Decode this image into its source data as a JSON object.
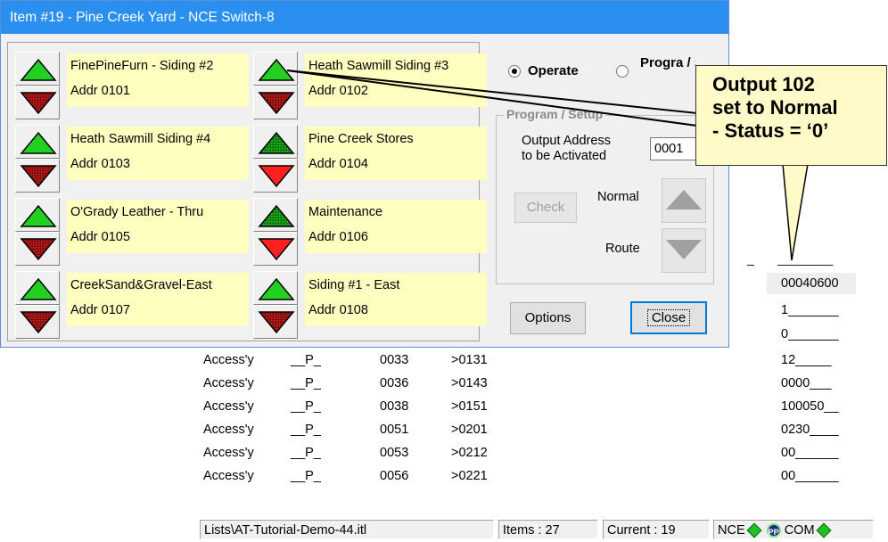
{
  "dialog": {
    "title": "Item #19 - Pine Creek Yard - NCE Switch-8",
    "switches": [
      {
        "name": "FinePineFurn - Siding #2",
        "addr": "Addr 0101",
        "up": "bright",
        "down": "dark"
      },
      {
        "name": "Heath Sawmill Siding #4",
        "addr": "Addr 0103",
        "up": "bright",
        "down": "dark"
      },
      {
        "name": "O'Grady Leather - Thru",
        "addr": "Addr 0105",
        "up": "bright",
        "down": "dark"
      },
      {
        "name": "CreekSand&Gravel-East",
        "addr": "Addr 0107",
        "up": "bright",
        "down": "dark"
      },
      {
        "name": "Heath Sawmill Siding #3",
        "addr": "Addr 0102",
        "up": "bright",
        "down": "dark"
      },
      {
        "name": "Pine Creek Stores",
        "addr": "Addr 0104",
        "up": "dark",
        "down": "bright"
      },
      {
        "name": "Maintenance",
        "addr": "Addr 0106",
        "up": "dark",
        "down": "bright"
      },
      {
        "name": "Siding #1 - East",
        "addr": "Addr 0108",
        "up": "bright",
        "down": "dark"
      }
    ],
    "mode": {
      "operate": "Operate",
      "program": "Progra / SetU"
    },
    "program_setup": {
      "title": "Program / Setup",
      "output_address_label_1": "Output Address",
      "output_address_label_2": "to be Activated",
      "output_address_value": "0001",
      "check": "Check",
      "normal": "Normal",
      "route": "Route"
    },
    "options": "Options",
    "close": "Close"
  },
  "callout": {
    "line1": "Output 102",
    "line2": "set to Normal",
    "line3": "- Status = ‘0’"
  },
  "background": {
    "dash": "_",
    "col_header_right": "________",
    "right_values": [
      "00040600",
      "1_______",
      "0_______"
    ],
    "rows": [
      {
        "type": "Access'y",
        "flag": "__P_",
        "num": "0033",
        "addr": ">0131",
        "val": "12_____"
      },
      {
        "type": "Access'y",
        "flag": "__P_",
        "num": "0036",
        "addr": ">0143",
        "val": "0000___"
      },
      {
        "type": "Access'y",
        "flag": "__P_",
        "num": "0038",
        "addr": ">0151",
        "val": "100050__"
      },
      {
        "type": "Access'y",
        "flag": "__P_",
        "num": "0051",
        "addr": ">0201",
        "val": "0230____"
      },
      {
        "type": "Access'y",
        "flag": "__P_",
        "num": "0053",
        "addr": ">0212",
        "val": "00______"
      },
      {
        "type": "Access'y",
        "flag": "__P_",
        "num": "0056",
        "addr": ">0221",
        "val": "00______"
      }
    ]
  },
  "statusbar": {
    "path": "Lists\\AT-Tutorial-Demo-44.itl",
    "items": "Items : 27",
    "current": "Current : 19",
    "nce": "NCE",
    "pp": "PP",
    "com": "COM"
  },
  "colors": {
    "green_bright": "#22d022",
    "red_bright": "#ff2020",
    "green_dark": "#0a7a0a",
    "red_dark": "#8a0a0a",
    "title_blue": "#2b8ff0",
    "label_bg": "#ffffc0",
    "callout_bg": "#fffac8"
  }
}
